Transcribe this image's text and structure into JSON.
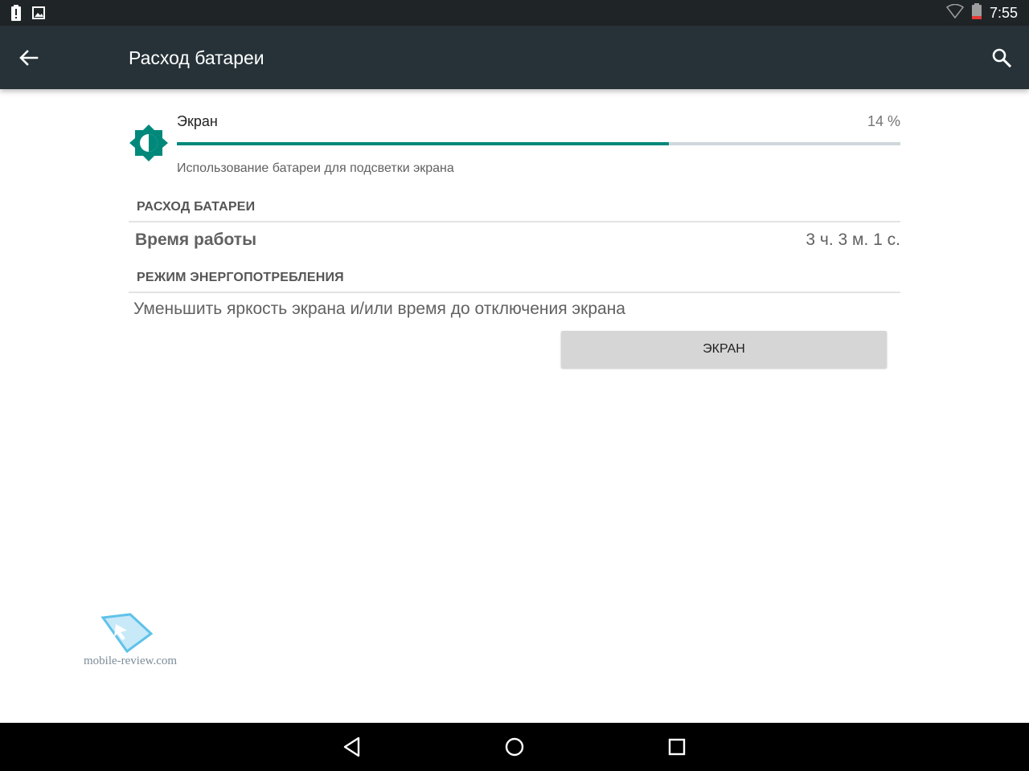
{
  "status_bar": {
    "time": "7:55",
    "icons": [
      "battery-alert-icon",
      "image-notification-icon",
      "wifi-icon",
      "battery-icon"
    ]
  },
  "app_bar": {
    "title": "Расход батареи",
    "back_icon": "arrow-back-icon",
    "search_icon": "search-icon"
  },
  "usage_item": {
    "icon": "brightness-icon",
    "name": "Экран",
    "percent_label": "14 %",
    "progress_fraction": 0.68,
    "description": "Использование батареи для подсветки экрана"
  },
  "battery_section": {
    "header": "РАСХОД БАТАРЕИ",
    "rows": [
      {
        "label": "Время работы",
        "value": "3 ч. 3 м. 1 с."
      }
    ]
  },
  "power_mode_section": {
    "header": "РЕЖИМ ЭНЕРГОПОТРЕБЛЕНИЯ",
    "hint": "Уменьшить яркость экрана и/или время до отключения экрана",
    "button_label": "ЭКРАН"
  },
  "watermark": {
    "text": "mobile-review.com"
  },
  "nav_bar": {
    "icons": [
      "back-triangle-icon",
      "home-circle-icon",
      "recents-square-icon"
    ]
  },
  "colors": {
    "status_bar": "#1f2427",
    "app_bar": "#263238",
    "accent": "#00897b",
    "track": "#cfd8dc",
    "button_bg": "#d6d6d6",
    "nav_bar": "#000000"
  }
}
